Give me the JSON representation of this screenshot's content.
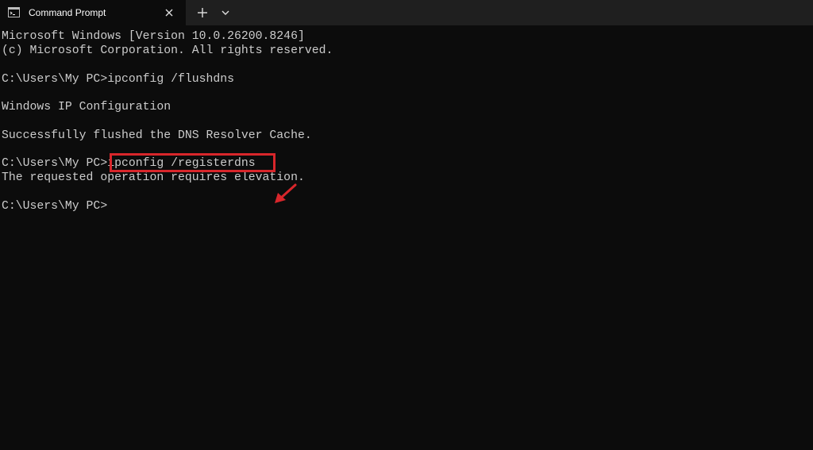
{
  "window": {
    "tab_title": "Command Prompt",
    "icons": {
      "tab_icon": "cmd-icon",
      "close": "close-icon",
      "new_tab": "plus-icon",
      "dropdown": "chevron-down-icon"
    }
  },
  "console": {
    "lines": [
      "Microsoft Windows [Version 10.0.26200.8246]",
      "(c) Microsoft Corporation. All rights reserved.",
      "",
      "C:\\Users\\My PC>ipconfig /flushdns",
      "",
      "Windows IP Configuration",
      "",
      "Successfully flushed the DNS Resolver Cache.",
      "",
      "C:\\Users\\My PC>ipconfig /registerdns",
      "The requested operation requires elevation.",
      "",
      "C:\\Users\\My PC>"
    ]
  },
  "annotation": {
    "highlighted_command": "ipconfig /registerdns",
    "color": "#d8262b"
  },
  "colors": {
    "background": "#0c0c0c",
    "titlebar": "#1f1f1f",
    "text": "#cccccc"
  }
}
